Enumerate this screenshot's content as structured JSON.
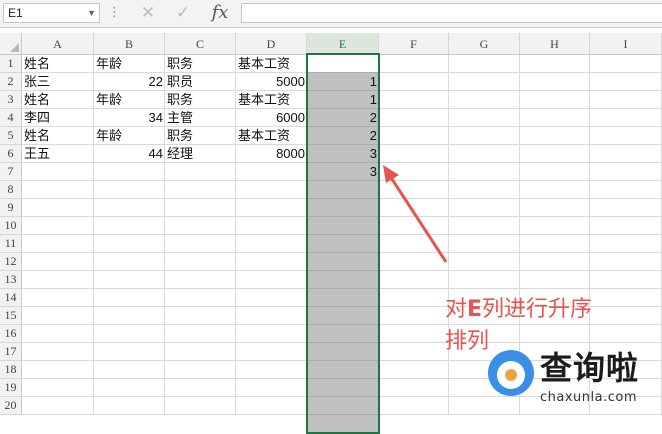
{
  "formula_bar": {
    "name_box": "E1",
    "formula": ""
  },
  "columns": [
    "A",
    "B",
    "C",
    "D",
    "E",
    "F",
    "G",
    "H",
    "I"
  ],
  "rows": [
    "1",
    "2",
    "3",
    "4",
    "5",
    "6",
    "7",
    "8",
    "9",
    "10",
    "11",
    "12",
    "13",
    "14",
    "15",
    "16",
    "17",
    "18",
    "19",
    "20"
  ],
  "cells": {
    "A1": "姓名",
    "B1": "年龄",
    "C1": "职务",
    "D1": "基本工资",
    "A2": "张三",
    "B2": "22",
    "C2": "职员",
    "D2": "5000",
    "E2": "1",
    "A3": "姓名",
    "B3": "年龄",
    "C3": "职务",
    "D3": "基本工资",
    "E3": "1",
    "A4": "李四",
    "B4": "34",
    "C4": "主管",
    "D4": "6000",
    "E4": "2",
    "A5": "姓名",
    "B5": "年龄",
    "C5": "职务",
    "D5": "基本工资",
    "E5": "2",
    "A6": "王五",
    "B6": "44",
    "C6": "经理",
    "D6": "8000",
    "E6": "3",
    "E7": "3"
  },
  "selected_column": "E",
  "annotation": {
    "line1_prefix": "对",
    "line1_em": "E",
    "line1_suffix": "列进行升序",
    "line2": "排列",
    "color": "#e6554f"
  },
  "watermark": {
    "brand": "查询啦",
    "domain": "chaxunla.com"
  },
  "icons": {
    "cancel": "close-icon",
    "enter": "check-icon",
    "function": "fx-icon"
  }
}
